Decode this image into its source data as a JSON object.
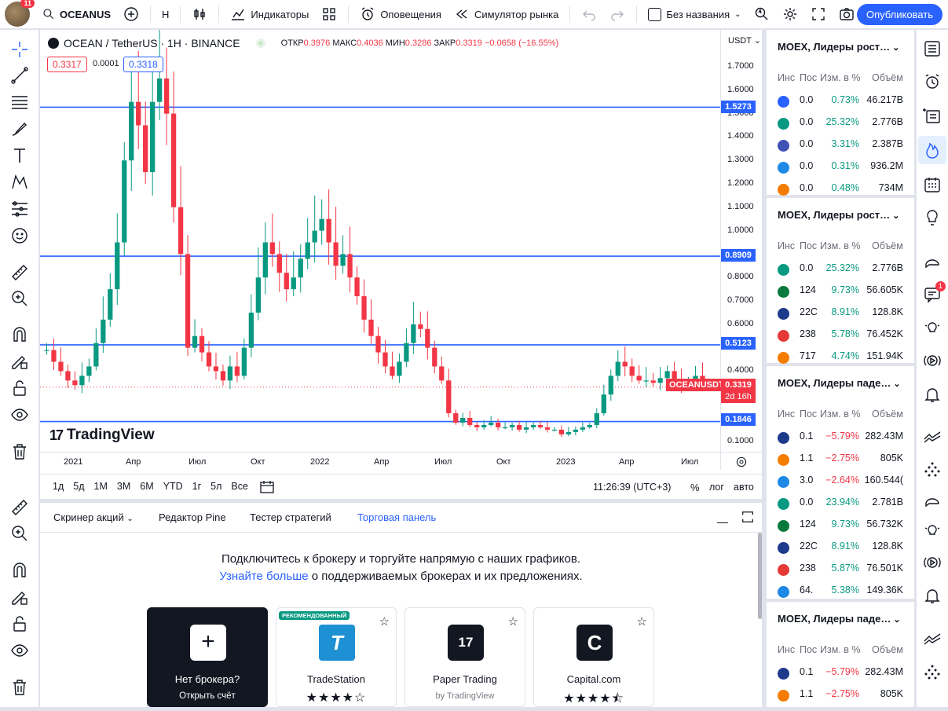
{
  "topbar": {
    "avatar_badge": "11",
    "symbol": "OCEANUS",
    "interval": "H",
    "indicators": "Индикаторы",
    "alerts": "Оповещения",
    "replay": "Симулятор рынка",
    "layout_name": "Без названия",
    "publish": "Опубликовать"
  },
  "legend": {
    "title": "OCEAN / TetherUS · 1H · BINANCE",
    "open_label": "ОТКР",
    "open": "0.3976",
    "high_label": "МАКС",
    "high": "0.4036",
    "low_label": "МИН",
    "low": "0.3286",
    "close_label": "ЗАКР",
    "close": "0.3319",
    "change": "−0.0658 (−16.55%)",
    "bid": "0.3317",
    "spread": "0.0001",
    "ask": "0.3318"
  },
  "price_axis": {
    "currency": "USDT",
    "ticks": [
      "1.7000",
      "1.6000",
      "1.5000",
      "1.4000",
      "1.3000",
      "1.2000",
      "1.1000",
      "1.0000",
      "0.9000",
      "0.8000",
      "0.7000",
      "0.6000",
      "0.5000",
      "0.4000",
      "0.3000",
      "0.2000",
      "0.1000"
    ],
    "levels": [
      "1.5273",
      "0.8909",
      "0.5123",
      "0.1846"
    ],
    "current_label": "OCEANUSDT",
    "current_price": "0.3319",
    "countdown": "2d 16h"
  },
  "time_axis": [
    "2021",
    "Апр",
    "Июл",
    "Окт",
    "2022",
    "Апр",
    "Июл",
    "Окт",
    "2023",
    "Апр",
    "Июл"
  ],
  "brand": "TradingView",
  "chart_toolbar": {
    "ranges": [
      "1д",
      "5д",
      "1М",
      "3М",
      "6М",
      "YTD",
      "1г",
      "5л",
      "Все"
    ],
    "time": "11:26:39 (UTC+3)",
    "percent": "%",
    "log": "лог",
    "auto": "авто"
  },
  "colors": {
    "up": "#089981",
    "down": "#f23645",
    "level": "#2962ff",
    "accent": "#2962ff"
  },
  "chart_data": {
    "type": "candlestick",
    "symbol": "OCEANUSDT",
    "levels": [
      1.5273,
      0.8909,
      0.5123,
      0.1846
    ],
    "close": [
      0.49,
      0.44,
      0.4,
      0.36,
      0.34,
      0.38,
      0.42,
      0.52,
      0.62,
      0.75,
      0.95,
      1.3,
      1.55,
      1.45,
      1.25,
      1.55,
      1.65,
      1.5,
      1.1,
      0.9,
      0.5,
      0.55,
      0.48,
      0.42,
      0.4,
      0.36,
      0.42,
      0.38,
      0.5,
      0.65,
      0.8,
      0.95,
      0.9,
      0.82,
      0.75,
      0.8,
      0.88,
      0.95,
      1.0,
      1.05,
      0.95,
      0.85,
      0.9,
      0.8,
      0.72,
      0.62,
      0.55,
      0.48,
      0.42,
      0.38,
      0.44,
      0.52,
      0.6,
      0.58,
      0.5,
      0.42,
      0.36,
      0.22,
      0.18,
      0.2,
      0.17,
      0.16,
      0.17,
      0.18,
      0.16,
      0.16,
      0.17,
      0.15,
      0.16,
      0.17,
      0.16,
      0.15,
      0.15,
      0.13,
      0.14,
      0.15,
      0.16,
      0.17,
      0.22,
      0.3,
      0.38,
      0.44,
      0.42,
      0.38,
      0.36,
      0.36,
      0.35,
      0.37,
      0.4,
      0.36,
      0.33,
      0.35,
      0.38,
      0.33
    ]
  },
  "bottom": {
    "tabs": [
      "Скринер акций",
      "Редактор Pine",
      "Тестер стратегий",
      "Торговая панель"
    ],
    "message": "Подключитесь к брокеру и торгуйте напрямую с наших графиков.",
    "link": "Узнайте больше",
    "message2": " о поддерживаемых брокерах и их предложениях.",
    "cards": [
      {
        "title": "Нет брокера?",
        "sub": "Открыть счёт"
      },
      {
        "badge": "РЕКОМЕНДОВАННЫЙ",
        "title": "TradeStation",
        "rating": "★★★★☆"
      },
      {
        "title": "Paper Trading",
        "sub": "by TradingView"
      },
      {
        "title": "Capital.com",
        "rating": "★★★★⯪"
      }
    ]
  },
  "watchlists": [
    {
      "title": "MOEX, Лидеры рост…",
      "headers": [
        "Инс",
        "Пос",
        "Изм. в %",
        "Объём"
      ],
      "rows": [
        [
          "0.0",
          "0.73%",
          "46.217B",
          "#2962ff"
        ],
        [
          "0.0",
          "25.32%",
          "2.776B",
          "#089981"
        ],
        [
          "0.0",
          "3.31%",
          "2.387B",
          "#3f51b5"
        ],
        [
          "0.0",
          "0.31%",
          "936.2M",
          "#1e88e5"
        ],
        [
          "0.0",
          "0.48%",
          "734M",
          "#f57c00"
        ]
      ]
    },
    {
      "title": "MOEX, Лидеры рост…",
      "headers": [
        "Инс",
        "Пос",
        "Изм. в %",
        "Объём"
      ],
      "rows": [
        [
          "0.0",
          "25.32%",
          "2.776B",
          "#089981"
        ],
        [
          "124",
          "9.73%",
          "56.605K",
          "#0a7a3c"
        ],
        [
          "22C",
          "8.91%",
          "128.8K",
          "#1e3a8a"
        ],
        [
          "238",
          "5.78%",
          "76.452K",
          "#e53935"
        ],
        [
          "717",
          "4.74%",
          "151.94K",
          "#f57c00"
        ]
      ]
    },
    {
      "title": "MOEX, Лидеры паде…",
      "headers": [
        "Инс",
        "Пос",
        "Изм. в %",
        "Объём"
      ],
      "rows": [
        [
          "0.1",
          "−5.79%",
          "282.43M",
          "#1e3a8a"
        ],
        [
          "1.1",
          "−2.75%",
          "805K",
          "#f57c00"
        ],
        [
          "3.0",
          "−2.64%",
          "160.544(",
          "#1e88e5"
        ],
        [
          "0.0",
          "23.94%",
          "2.781B",
          "#089981"
        ],
        [
          "124",
          "9.73%",
          "56.732K",
          "#0a7a3c"
        ],
        [
          "22C",
          "8.91%",
          "128.8K",
          "#1e3a8a"
        ],
        [
          "238",
          "5.87%",
          "76.501K",
          "#e53935"
        ],
        [
          "64.",
          "5.38%",
          "149.36K",
          "#1e88e5"
        ]
      ]
    },
    {
      "title": "MOEX, Лидеры паде…",
      "headers": [
        "Инс",
        "Пос",
        "Изм. в %",
        "Объём"
      ],
      "rows": [
        [
          "0.1",
          "−5.79%",
          "282.43M",
          "#1e3a8a"
        ],
        [
          "1.1",
          "−2.75%",
          "805K",
          "#f57c00"
        ]
      ]
    }
  ],
  "rightbar": {
    "chat_badge": "1"
  }
}
